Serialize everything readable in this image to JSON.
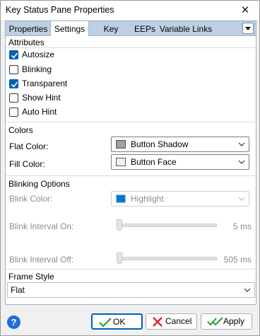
{
  "window": {
    "title": "Key Status Pane Properties"
  },
  "tabs": [
    {
      "label": "Properties",
      "active": false
    },
    {
      "label": "Settings",
      "active": true
    },
    {
      "label": "Key Status",
      "active": false
    },
    {
      "label": "EEPs",
      "active": false
    },
    {
      "label": "Variable Links",
      "active": false
    }
  ],
  "attributes": {
    "title": "Attributes",
    "items": [
      {
        "label": "Autosize",
        "checked": true
      },
      {
        "label": "Blinking",
        "checked": false
      },
      {
        "label": "Transparent",
        "checked": true
      },
      {
        "label": "Show Hint",
        "checked": false
      },
      {
        "label": "Auto Hint",
        "checked": false
      }
    ]
  },
  "colors": {
    "title": "Colors",
    "flat_label": "Flat Color:",
    "flat_value": "Button Shadow",
    "flat_swatch": "#a0a0a0",
    "fill_label": "Fill Color:",
    "fill_value": "Button Face",
    "fill_swatch": "#f0f0f0"
  },
  "blinking": {
    "title": "Blinking Options",
    "color_label": "Blink Color:",
    "color_value": "Highlight",
    "color_swatch": "#0078d7",
    "on_label": "Blink Interval On:",
    "on_value": "5 ms",
    "off_label": "Blink Interval Off:",
    "off_value": "505 ms"
  },
  "frame": {
    "title": "Frame Style",
    "value": "Flat"
  },
  "buttons": {
    "ok": "OK",
    "cancel": "Cancel",
    "apply": "Apply"
  }
}
